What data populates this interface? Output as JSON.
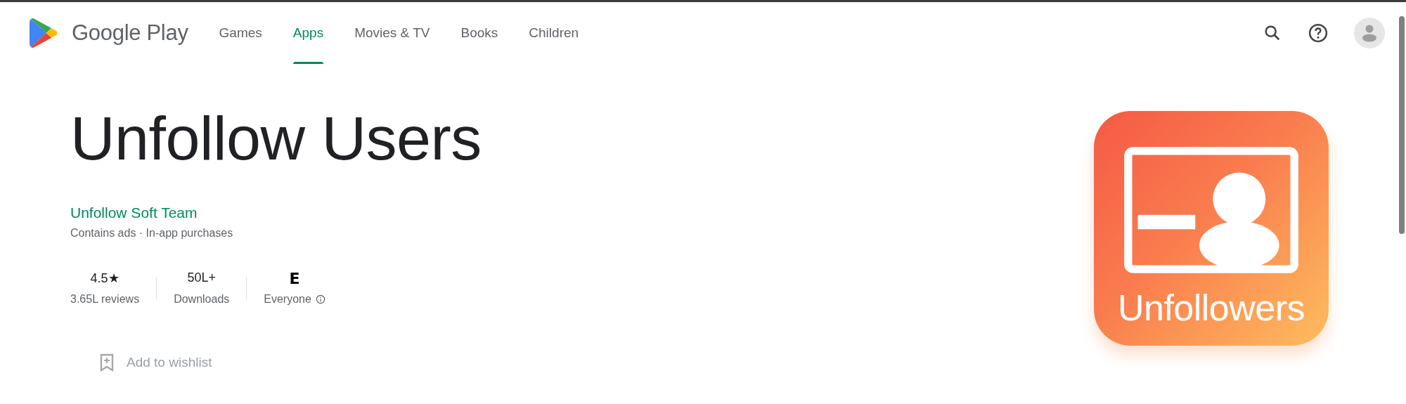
{
  "header": {
    "brand": "Google Play",
    "nav": [
      {
        "label": "Games",
        "selected": false
      },
      {
        "label": "Apps",
        "selected": true
      },
      {
        "label": "Movies & TV",
        "selected": false
      },
      {
        "label": "Books",
        "selected": false
      },
      {
        "label": "Children",
        "selected": false
      }
    ]
  },
  "app": {
    "title": "Unfollow Users",
    "developer": "Unfollow Soft Team",
    "notes": "Contains ads · In-app purchases",
    "stats": [
      {
        "kind": "text",
        "value": "4.5★",
        "label": "3.65L reviews"
      },
      {
        "kind": "text",
        "value": "50L+",
        "label": "Downloads"
      },
      {
        "kind": "badge",
        "value": "E",
        "label": "Everyone"
      }
    ],
    "wishlist": "Add to wishlist",
    "icon_text": "Unfollowers"
  }
}
